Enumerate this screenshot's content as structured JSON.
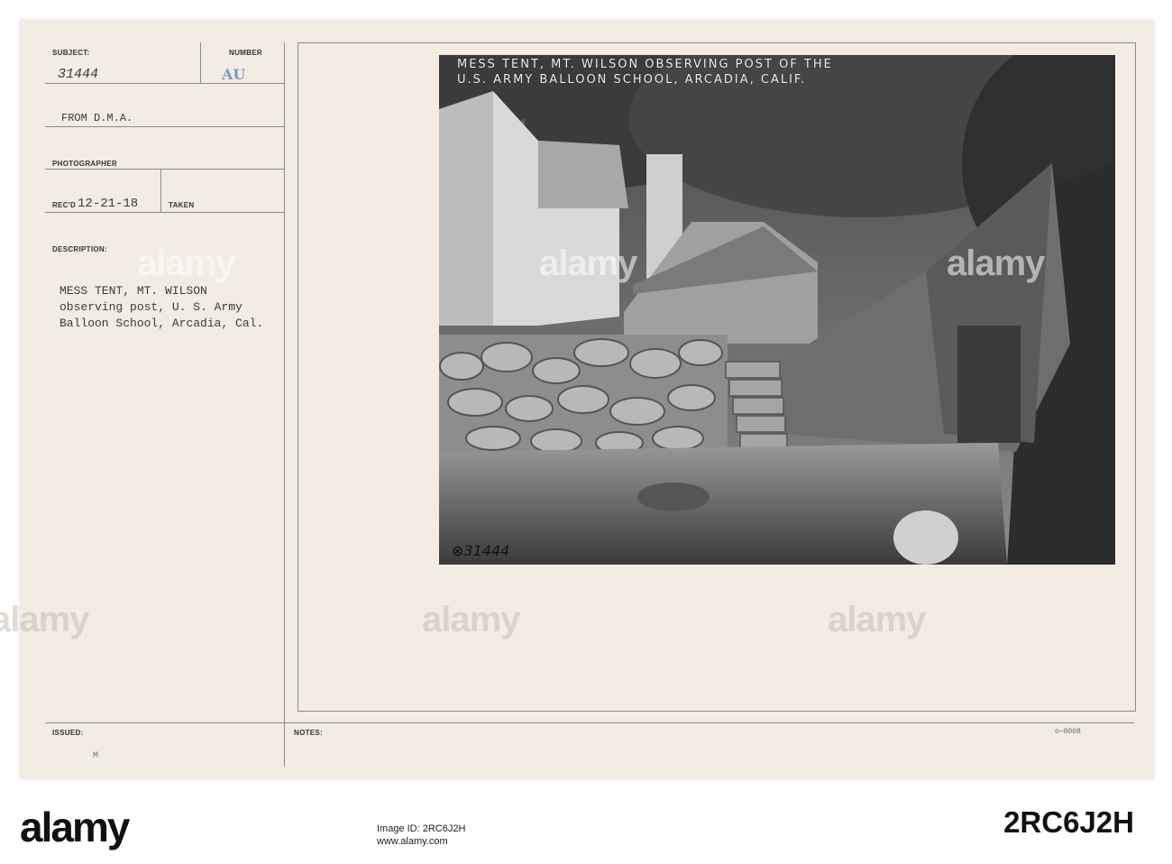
{
  "card": {
    "subject_label": "SUBJECT:",
    "subject_value": "31444",
    "number_label": "NUMBER",
    "number_stamp": "AU",
    "from_value": "FROM D.M.A.",
    "photographer_label": "PHOTOGRAPHER",
    "recd_label": "REC'D",
    "recd_value": "12-21-18",
    "taken_label": "TAKEN",
    "description_label": "DESCRIPTION:",
    "description_lines": [
      "MESS TENT, MT. WILSON",
      "observing post, U. S. Army",
      "Balloon School, Arcadia, Cal."
    ],
    "issued_label": "ISSUED:",
    "notes_label": "NOTES:",
    "issued_mark": "M",
    "corner_code": "o—0008"
  },
  "photo": {
    "caption_line1": "MESS TENT, MT. WILSON OBSERVING POST OF THE",
    "caption_line2": "U.S. ARMY BALLOON SCHOOL, ARCADIA, CALIF.",
    "negative_number": "⊗31444"
  },
  "watermark": {
    "text": "alamy"
  },
  "footer": {
    "brand": "alamy",
    "image_id": "2RC6J2H",
    "side_lines": [
      "Image ID: 2RC6J2H",
      "www.alamy.com"
    ]
  },
  "colors": {
    "card_bg": "#f3ece3",
    "rule": "#8f8a86",
    "stamp_blue": "#7c9bbd"
  }
}
